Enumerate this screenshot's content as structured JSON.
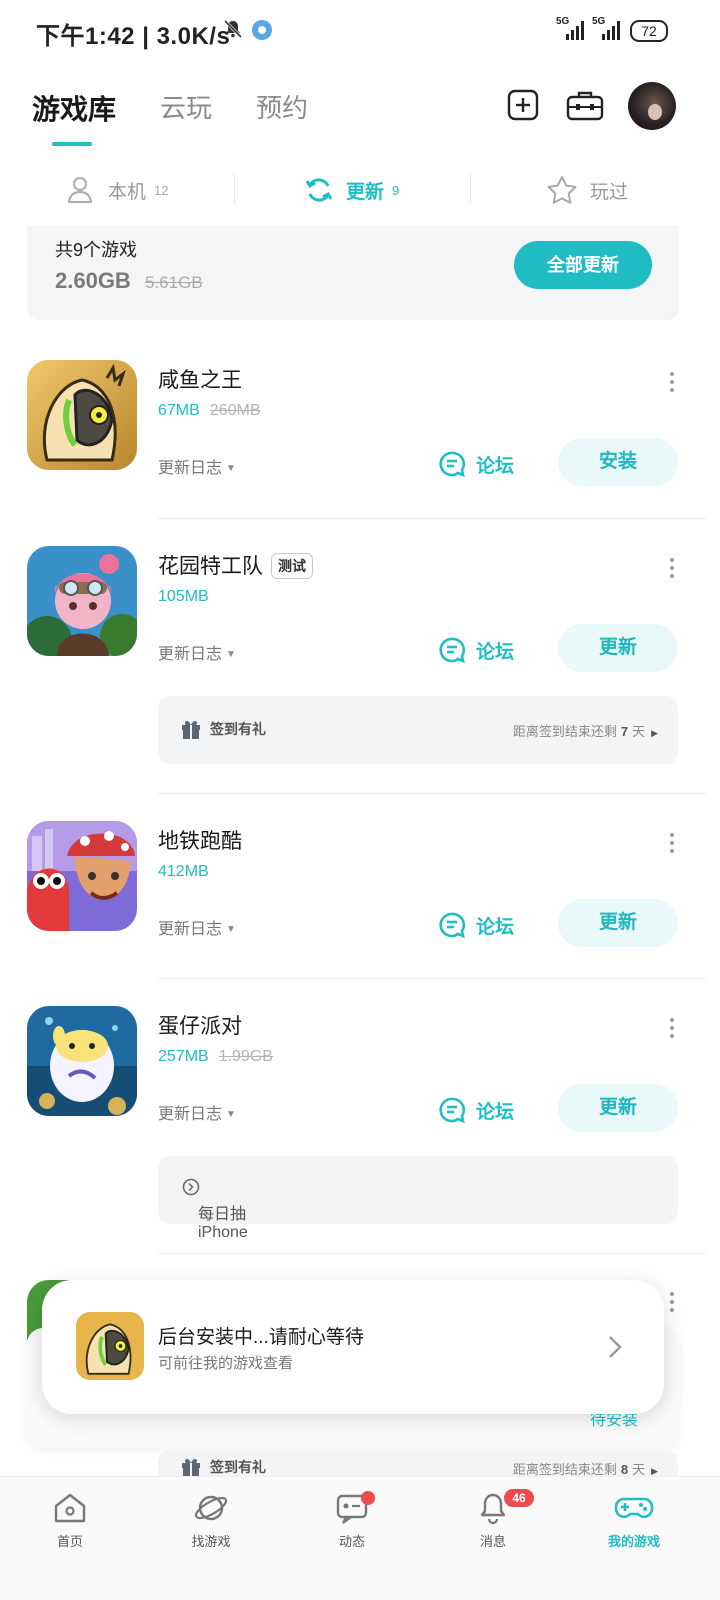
{
  "status_bar": {
    "time": "下午1:42 | 3.0K/s",
    "network_a": "5G",
    "network_b": "5G",
    "battery": "72"
  },
  "header": {
    "tabs": [
      {
        "label": "游戏库",
        "active": true
      },
      {
        "label": "云玩",
        "active": false
      },
      {
        "label": "预约",
        "active": false
      }
    ]
  },
  "subtabs": [
    {
      "label": "本机",
      "count": "12",
      "icon": "person-icon"
    },
    {
      "label": "更新",
      "count": "9",
      "icon": "refresh-icon",
      "active": true
    },
    {
      "label": "玩过",
      "count": "",
      "icon": "star-icon"
    }
  ],
  "summary": {
    "count_text": "共9个游戏",
    "size": "2.60GB",
    "old_size": "5.61GB",
    "update_all": "全部更新"
  },
  "games": [
    {
      "name": "咸鱼之王",
      "size": "67MB",
      "old_size": "260MB",
      "changelog": "更新日志",
      "forum": "论坛",
      "action": "安装"
    },
    {
      "name": "花园特工队",
      "badge": "测试",
      "size": "105MB",
      "old_size": "",
      "changelog": "更新日志",
      "forum": "论坛",
      "action": "更新",
      "promo": {
        "left": "签到有礼",
        "right_prefix": "距离签到结束还剩",
        "days": "7",
        "right_suffix": "天"
      }
    },
    {
      "name": "地铁跑酷",
      "size": "412MB",
      "old_size": "",
      "changelog": "更新日志",
      "forum": "论坛",
      "action": "更新"
    },
    {
      "name": "蛋仔派对",
      "size": "257MB",
      "old_size": "1.99GB",
      "changelog": "更新日志",
      "forum": "论坛",
      "action": "更新",
      "promo_text": "每日抽 iPhone"
    }
  ],
  "partial_row": {
    "action": "待安装",
    "promo": {
      "left": "签到有礼",
      "right_prefix": "距离签到结束还剩",
      "days": "8",
      "right_suffix": "天"
    }
  },
  "toast": {
    "title": "后台安装中...请耐心等待",
    "subtitle": "可前往我的游戏查看"
  },
  "bottom_nav": [
    {
      "label": "首页",
      "icon": "home-icon"
    },
    {
      "label": "找游戏",
      "icon": "planet-icon"
    },
    {
      "label": "动态",
      "icon": "chat-icon",
      "dot": true
    },
    {
      "label": "消息",
      "icon": "bell-icon",
      "badge": "46"
    },
    {
      "label": "我的游戏",
      "icon": "gamepad-icon",
      "active": true
    }
  ],
  "colors": {
    "accent": "#1fbdc4",
    "badge": "#ee4c4c"
  }
}
